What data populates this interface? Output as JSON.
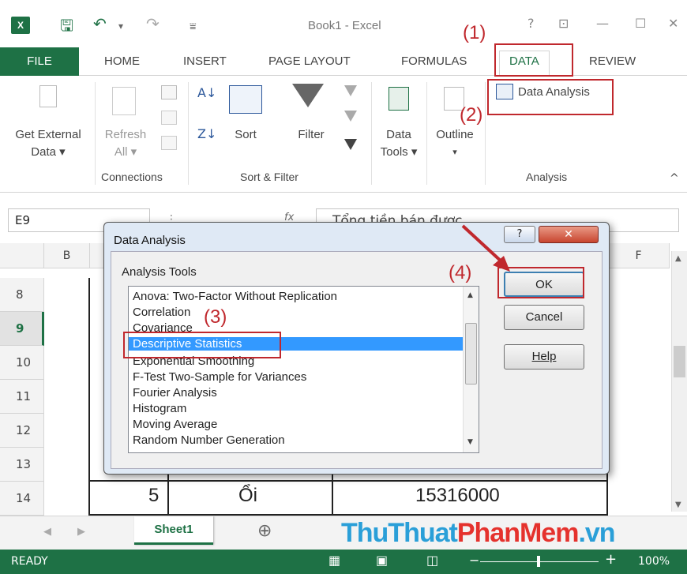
{
  "window": {
    "title": "Book1 - Excel",
    "logo": "X",
    "help": "?",
    "restore": "⊡",
    "minimize": "—",
    "maximize": "☐",
    "close": "✕"
  },
  "tabs": [
    "FILE",
    "HOME",
    "INSERT",
    "PAGE LAYOUT",
    "FORMULAS",
    "DATA",
    "REVIEW"
  ],
  "ribbon": {
    "get_external_data": [
      "Get External",
      "Data ▾"
    ],
    "refresh": [
      "Refresh",
      "All ▾"
    ],
    "connections_group": "Connections",
    "sort": "Sort",
    "filter": "Filter",
    "sort_filter_group": "Sort & Filter",
    "data_tools": [
      "Data",
      "Tools ▾"
    ],
    "outline": [
      "Outline",
      "▾"
    ],
    "data_analysis": "Data Analysis",
    "analysis_group": "Analysis",
    "collapse": "^"
  },
  "formula_bar": {
    "name_box": "E9",
    "fx": "fx",
    "content": "Tổng tiền bán được"
  },
  "grid": {
    "columns": [
      "B",
      "F"
    ],
    "rows": [
      "8",
      "9",
      "10",
      "11",
      "12",
      "13",
      "14"
    ],
    "selected_row": "9",
    "row14": {
      "stt": "5",
      "name": "Ổi",
      "amount": "15316000"
    }
  },
  "sheets": {
    "active": "Sheet1",
    "add": "⊕"
  },
  "watermark": {
    "part1": "ThuThuat",
    "part2": "PhanMem",
    "part3": ".vn"
  },
  "status": {
    "mode": "READY",
    "zoom": "100%"
  },
  "dialog": {
    "title": "Data Analysis",
    "help_icon": "?",
    "close_icon": "✕",
    "tools_label": "Analysis Tools",
    "items": [
      "Anova: Two-Factor Without Replication",
      "Correlation",
      "Covariance",
      "Descriptive Statistics",
      "Exponential Smoothing",
      "F-Test Two-Sample for Variances",
      "Fourier Analysis",
      "Histogram",
      "Moving Average",
      "Random Number Generation"
    ],
    "selected_item": "Descriptive Statistics",
    "ok": "OK",
    "cancel": "Cancel",
    "help": "Help"
  },
  "annotations": [
    "(1)",
    "(2)",
    "(3)",
    "(4)"
  ],
  "colors": {
    "excel_green": "#1e7145",
    "annotation_red": "#c0282d",
    "selection_blue": "#3399ff"
  }
}
